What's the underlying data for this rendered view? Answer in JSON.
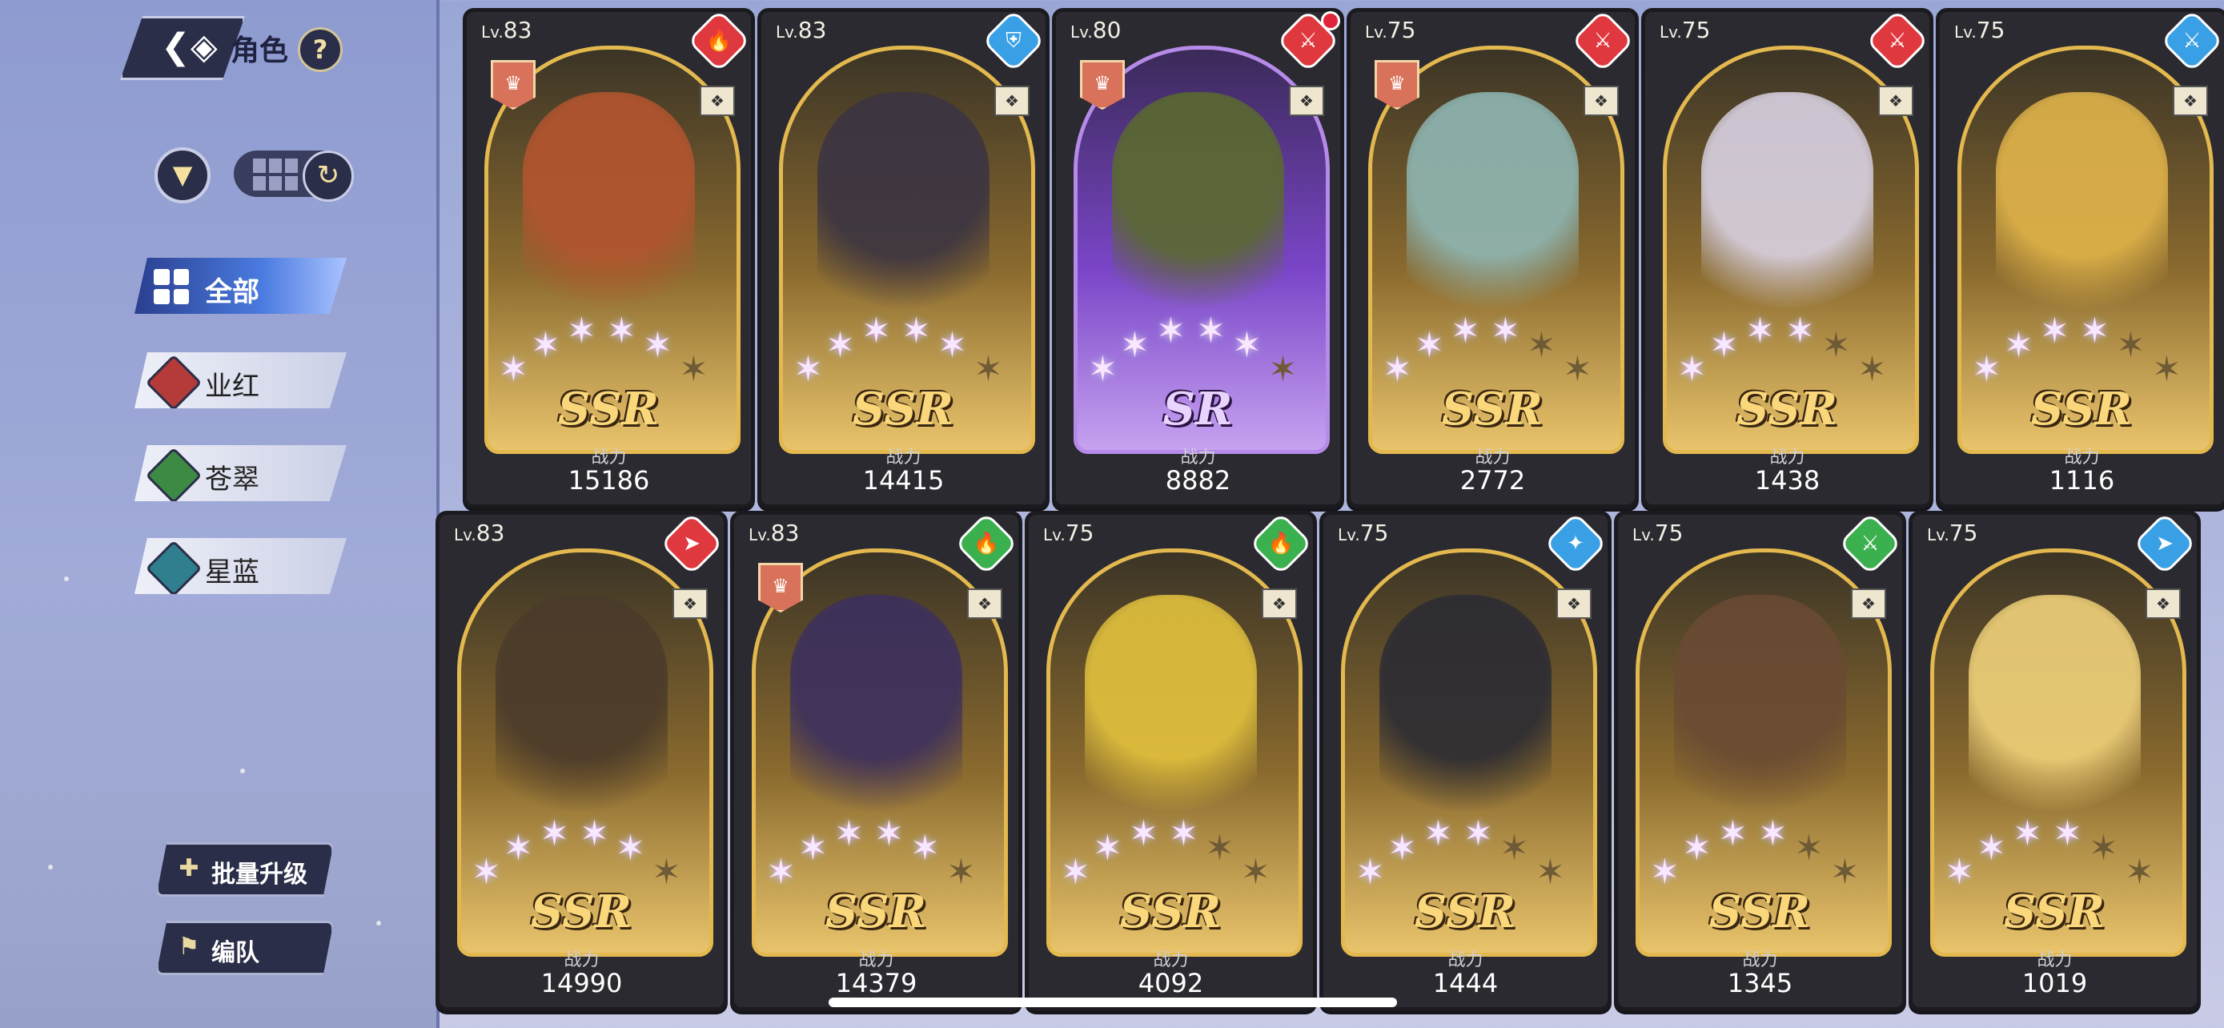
{
  "header": {
    "title": "角色",
    "help": "?"
  },
  "filters": [
    {
      "label": "全部",
      "color": "#3b63d1",
      "active": true
    },
    {
      "label": "业红",
      "color": "#b53a3a",
      "active": false
    },
    {
      "label": "苍翠",
      "color": "#3d8a45",
      "active": false
    },
    {
      "label": "星蓝",
      "color": "#2f7f8e",
      "active": false
    }
  ],
  "actions": {
    "batch_upgrade": "批量升级",
    "team": "编队"
  },
  "power_label": "战力",
  "cards": [
    {
      "level": "83",
      "element_color": "#e0383f",
      "element_icon": "flame",
      "leader": true,
      "rarity": "SSR",
      "stars": 5,
      "power": "15186",
      "figure_color": "#b4552e"
    },
    {
      "level": "83",
      "element_color": "#3aa0e6",
      "element_icon": "shield",
      "leader": false,
      "rarity": "SSR",
      "stars": 5,
      "power": "14415",
      "figure_color": "#3a3342"
    },
    {
      "level": "80",
      "element_color": "#e0383f",
      "element_icon": "sword",
      "leader": true,
      "rarity": "SR",
      "stars": 5,
      "power": "8882",
      "figure_color": "#5a6a2e"
    },
    {
      "level": "75",
      "element_color": "#e0383f",
      "element_icon": "sword",
      "leader": true,
      "rarity": "SSR",
      "stars": 4,
      "power": "2772",
      "figure_color": "#8fb7b4"
    },
    {
      "level": "75",
      "element_color": "#e0383f",
      "element_icon": "sword",
      "leader": false,
      "rarity": "SSR",
      "stars": 4,
      "power": "1438",
      "figure_color": "#d9d2e2"
    },
    {
      "level": "75",
      "element_color": "#3aa0e6",
      "element_icon": "sword",
      "leader": false,
      "rarity": "SSR",
      "stars": 4,
      "power": "1116",
      "figure_color": "#e1b44a"
    },
    {
      "level": "83",
      "element_color": "#e0383f",
      "element_icon": "boot",
      "leader": false,
      "rarity": "SSR",
      "stars": 5,
      "power": "14990",
      "figure_color": "#4a3a2a"
    },
    {
      "level": "83",
      "element_color": "#3bb04f",
      "element_icon": "flame",
      "leader": true,
      "rarity": "SSR",
      "stars": 5,
      "power": "14379",
      "figure_color": "#3c2f5e"
    },
    {
      "level": "75",
      "element_color": "#3bb04f",
      "element_icon": "flame",
      "leader": false,
      "rarity": "SSR",
      "stars": 4,
      "power": "4092",
      "figure_color": "#e3c23d"
    },
    {
      "level": "75",
      "element_color": "#3aa0e6",
      "element_icon": "wand",
      "leader": false,
      "rarity": "SSR",
      "stars": 4,
      "power": "1444",
      "figure_color": "#2b2b33"
    },
    {
      "level": "75",
      "element_color": "#3bb04f",
      "element_icon": "sword",
      "leader": false,
      "rarity": "SSR",
      "stars": 4,
      "power": "1345",
      "figure_color": "#6a4a33"
    },
    {
      "level": "75",
      "element_color": "#3aa0e6",
      "element_icon": "boot",
      "leader": false,
      "rarity": "SSR",
      "stars": 4,
      "power": "1019",
      "figure_color": "#f0d27a"
    }
  ]
}
